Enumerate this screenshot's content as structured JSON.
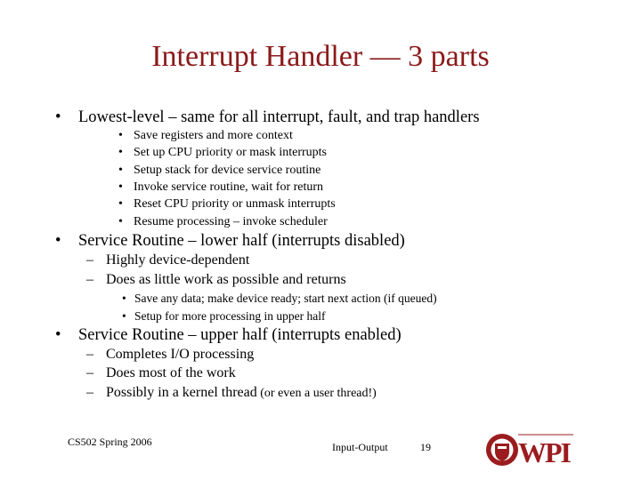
{
  "title": "Interrupt Handler — 3 parts",
  "bullet_char": "•",
  "dash_char": "–",
  "sections": [
    {
      "heading": "Lowest-level – same for all interrupt, fault, and trap handlers",
      "items": [
        "Save registers and more context",
        "Set up CPU priority or mask interrupts",
        "Setup stack for device service routine",
        "Invoke service routine, wait for return",
        "Reset CPU priority or unmask interrupts",
        "Resume processing – invoke scheduler"
      ]
    },
    {
      "heading": "Service Routine – lower half (interrupts disabled)",
      "items": [
        "Highly device-dependent",
        "Does as little work as possible and returns"
      ],
      "subitems": [
        "Save any data; make device ready; start next action (if queued)",
        "Setup for more processing in upper half"
      ]
    },
    {
      "heading": "Service Routine – upper half (interrupts enabled)",
      "items": [
        "Completes I/O processing",
        "Does most of the work",
        "Possibly in a kernel thread"
      ],
      "last_item_suffix": " (or even a user thread!)"
    }
  ],
  "footer": {
    "course": "CS502 Spring 2006",
    "topic": "Input-Output",
    "page": "19",
    "logo_text": "WPI"
  },
  "colors": {
    "title": "#8b1a1a",
    "logo": "#9b1c1f"
  }
}
